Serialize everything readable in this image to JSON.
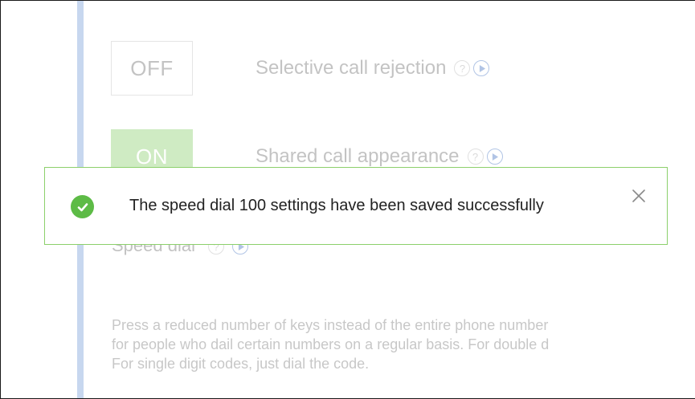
{
  "features": [
    {
      "toggle_label": "OFF",
      "label": "Selective call rejection",
      "help_icon": "question-circle-icon",
      "play_icon": "play-circle-icon"
    },
    {
      "toggle_label": "ON",
      "label": "Shared call appearance",
      "help_icon": "question-circle-icon",
      "play_icon": "play-circle-icon"
    }
  ],
  "speed_dial": {
    "title": "Speed dial",
    "description_lines": [
      "Press a reduced number of keys instead of the entire phone number",
      "for people who dail certain numbers on a regular basis. For double d",
      "For single digit codes, just dial the code."
    ]
  },
  "toast": {
    "message": "The speed dial 100 settings have been saved successfully",
    "status_icon": "check-circle-icon",
    "close_icon": "close-icon"
  },
  "colors": {
    "accent_bar": "#c7d7ef",
    "toggle_on": "#7cc95c",
    "toast_border": "#8cd06b",
    "success_icon": "#5dbb46",
    "info_icon": "#2a5fb8"
  }
}
